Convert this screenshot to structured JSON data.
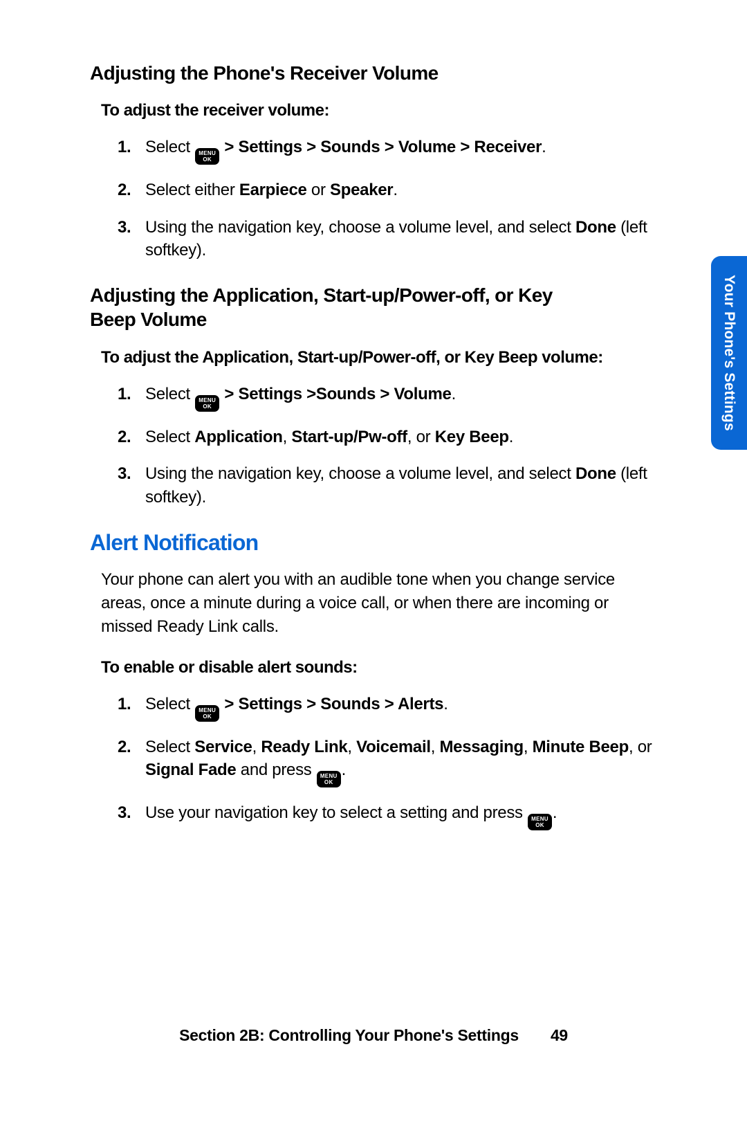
{
  "menuKey": {
    "line1": "MENU",
    "line2": "OK"
  },
  "sideTab": "Your Phone's Settings",
  "footer": {
    "text": "Section 2B: Controlling Your Phone's Settings",
    "page": "49"
  },
  "sectionA": {
    "heading": "Adjusting the Phone's Receiver Volume",
    "sub": "To adjust the receiver volume:",
    "steps": [
      {
        "n": "1.",
        "pre": "Select ",
        "postBold": " > Settings > Sounds > Volume > Receiver",
        "tail": "."
      },
      {
        "n": "2.",
        "pre": "Select either ",
        "bold1": "Earpiece",
        "mid": " or ",
        "bold2": "Speaker",
        "tail": "."
      },
      {
        "n": "3.",
        "pre": "Using the navigation key, choose a volume level, and select ",
        "bold1": "Done",
        "tail": " (left softkey)."
      }
    ]
  },
  "sectionB": {
    "heading": "Adjusting the Application, Start-up/Power-off, or Key Beep Volume",
    "sub": "To adjust the Application, Start-up/Power-off, or Key Beep volume:",
    "steps": [
      {
        "n": "1.",
        "pre": "Select ",
        "postBold": " > Settings >Sounds > Volume",
        "tail": "."
      },
      {
        "n": "2.",
        "pre": "Select ",
        "bold1": "Application",
        "mid1": ", ",
        "bold2": "Start-up/Pw-off",
        "mid2": ", or ",
        "bold3": "Key Beep",
        "tail": "."
      },
      {
        "n": "3.",
        "pre": "Using the navigation key, choose a volume level, and select ",
        "bold1": "Done",
        "tail": " (left softkey)."
      }
    ]
  },
  "alert": {
    "title": "Alert Notification",
    "para": "Your phone can alert you with an audible tone when you change service areas, once a minute during a voice call, or when there are incoming or missed Ready Link calls.",
    "sub": "To enable or disable alert sounds:",
    "steps": [
      {
        "n": "1.",
        "pre": "Select ",
        "postBold": " > Settings > Sounds > Alerts",
        "tail": "."
      },
      {
        "n": "2.",
        "pre": "Select ",
        "bold1": "Service",
        "s1": ", ",
        "bold2": "Ready Link",
        "s2": ", ",
        "bold3": "Voicemail",
        "s3": ", ",
        "bold4": "Messaging",
        "s4": ", ",
        "bold5": "Minute Beep",
        "s5": ", or ",
        "bold6": "Signal Fade",
        "mid": " and press ",
        "key": true,
        "tail": "."
      },
      {
        "n": "3.",
        "pre": "Use your navigation key to select a setting and press ",
        "key": true,
        "tail": "."
      }
    ]
  }
}
